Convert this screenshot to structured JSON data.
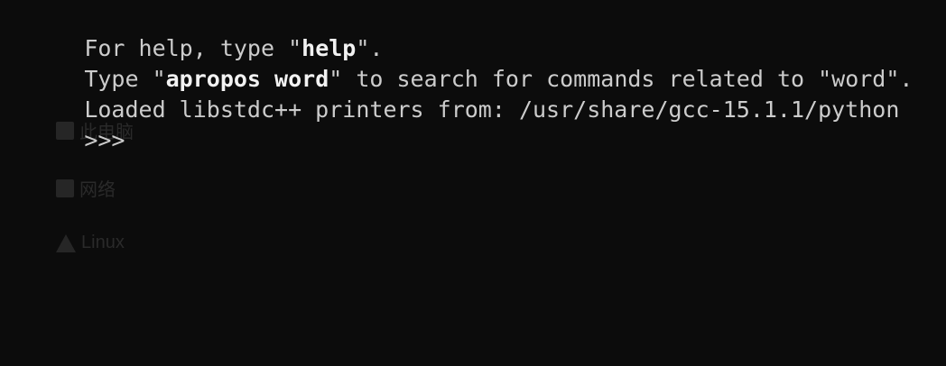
{
  "terminal": {
    "lines": [
      {
        "segments": [
          {
            "text": "For help, type \"",
            "bold": false
          },
          {
            "text": "help",
            "bold": true
          },
          {
            "text": "\".",
            "bold": false
          }
        ]
      },
      {
        "segments": [
          {
            "text": "Type \"",
            "bold": false
          },
          {
            "text": "apropos word",
            "bold": true
          },
          {
            "text": "\" to search for commands related to \"word\".",
            "bold": false
          }
        ]
      },
      {
        "segments": [
          {
            "text": "Loaded libstdc++ printers from: /usr/share/gcc-15.1.1/python",
            "bold": false
          }
        ]
      }
    ],
    "prompt": ">>>"
  },
  "colors": {
    "background": "#0c0c0c",
    "text": "#cccccc",
    "bold_text": "#f2f2f2"
  },
  "background_ghost": {
    "items": [
      {
        "label": "此电脑",
        "icon": "computer-icon"
      },
      {
        "label": "网络",
        "icon": "network-icon"
      },
      {
        "label": "Linux",
        "icon": "linux-icon"
      }
    ]
  }
}
